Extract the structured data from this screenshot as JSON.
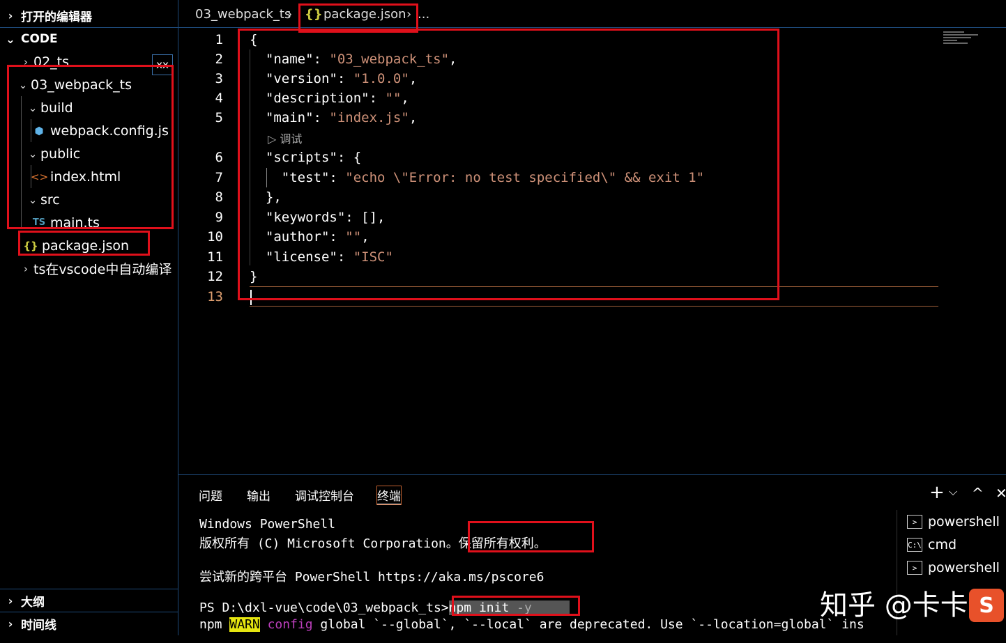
{
  "sidebar": {
    "open_editors_label": "打开的编辑器",
    "workspace_label": "CODE",
    "outline_label": "大纲",
    "timeline_label": "时间线",
    "close_all_label": "xx",
    "tree": [
      {
        "label": "02_ts",
        "type": "folder",
        "expanded": false
      },
      {
        "label": "03_webpack_ts",
        "type": "folder",
        "expanded": true
      },
      {
        "label": "build",
        "type": "folder",
        "expanded": true
      },
      {
        "label": "webpack.config.js",
        "type": "file",
        "icon": "webpack-icon"
      },
      {
        "label": "public",
        "type": "folder",
        "expanded": true
      },
      {
        "label": "index.html",
        "type": "file",
        "icon": "html-icon"
      },
      {
        "label": "src",
        "type": "folder",
        "expanded": true
      },
      {
        "label": "main.ts",
        "type": "file",
        "icon": "ts-icon",
        "icon_text": "TS"
      },
      {
        "label": "package.json",
        "type": "file",
        "icon": "json-icon",
        "icon_text": "{}"
      },
      {
        "label": "ts在vscode中自动编译",
        "type": "folder",
        "expanded": false
      }
    ]
  },
  "breadcrumb": {
    "folder": "03_webpack_ts",
    "file": "package.json",
    "file_icon": "{}",
    "more": "..."
  },
  "editor": {
    "codelens": "▷ 调试",
    "lines": [
      {
        "n": "1",
        "code": "{"
      },
      {
        "n": "2",
        "key": "\"name\"",
        "value": "\"03_webpack_ts\"",
        "tail": ","
      },
      {
        "n": "3",
        "key": "\"version\"",
        "value": "\"1.0.0\"",
        "tail": ","
      },
      {
        "n": "4",
        "key": "\"description\"",
        "value": "\"\"",
        "tail": ","
      },
      {
        "n": "5",
        "key": "\"main\"",
        "value": "\"index.js\"",
        "tail": ","
      },
      {
        "n": "6",
        "key": "\"scripts\"",
        "value": "",
        "tail": "{"
      },
      {
        "n": "7",
        "key": "\"test\"",
        "value": "\"echo \\\"Error: no test specified\\\" && exit 1\"",
        "tail": ""
      },
      {
        "n": "8",
        "code": "},"
      },
      {
        "n": "9",
        "key": "\"keywords\"",
        "value": "",
        "tail": "[],"
      },
      {
        "n": "10",
        "key": "\"author\"",
        "value": "\"\"",
        "tail": ","
      },
      {
        "n": "11",
        "key": "\"license\"",
        "value": "\"ISC\"",
        "tail": ""
      },
      {
        "n": "12",
        "code": "}"
      },
      {
        "n": "13",
        "code": ""
      }
    ]
  },
  "panel": {
    "tabs": [
      "问题",
      "输出",
      "调试控制台",
      "终端"
    ],
    "active_tab": "终端",
    "actions": {
      "add": "+",
      "dropdown": "⌵",
      "maximize": "^",
      "close": "✕"
    },
    "terminal_lines": {
      "l1": "Windows PowerShell",
      "l2a": "版权所有 (C) Microsoft Corporation。",
      "l2b": "保留所有权利。",
      "l3": "尝试新的跨平台 PowerShell https://aka.ms/pscore6",
      "prompt": "PS D:\\dxl-vue\\code\\03_webpack_ts>",
      "cmd": "npm init",
      "cmd_flag": "-y",
      "w1": "npm ",
      "w2": "WARN",
      "w3": " ",
      "w4": "config",
      "w5": " global `--global`, `--local` are deprecated. Use `--location=global` ins"
    },
    "terminals": [
      {
        "label": "powershell",
        "icon": ">"
      },
      {
        "label": "cmd",
        "icon": "C:\\"
      },
      {
        "label": "powershell",
        "icon": ">"
      }
    ]
  },
  "watermark": {
    "text": "知乎 @卡卡",
    "logo": "S"
  },
  "colors": {
    "string": "#ce9178",
    "highlight_box": "#e0101b",
    "border": "#1e4a7a"
  }
}
